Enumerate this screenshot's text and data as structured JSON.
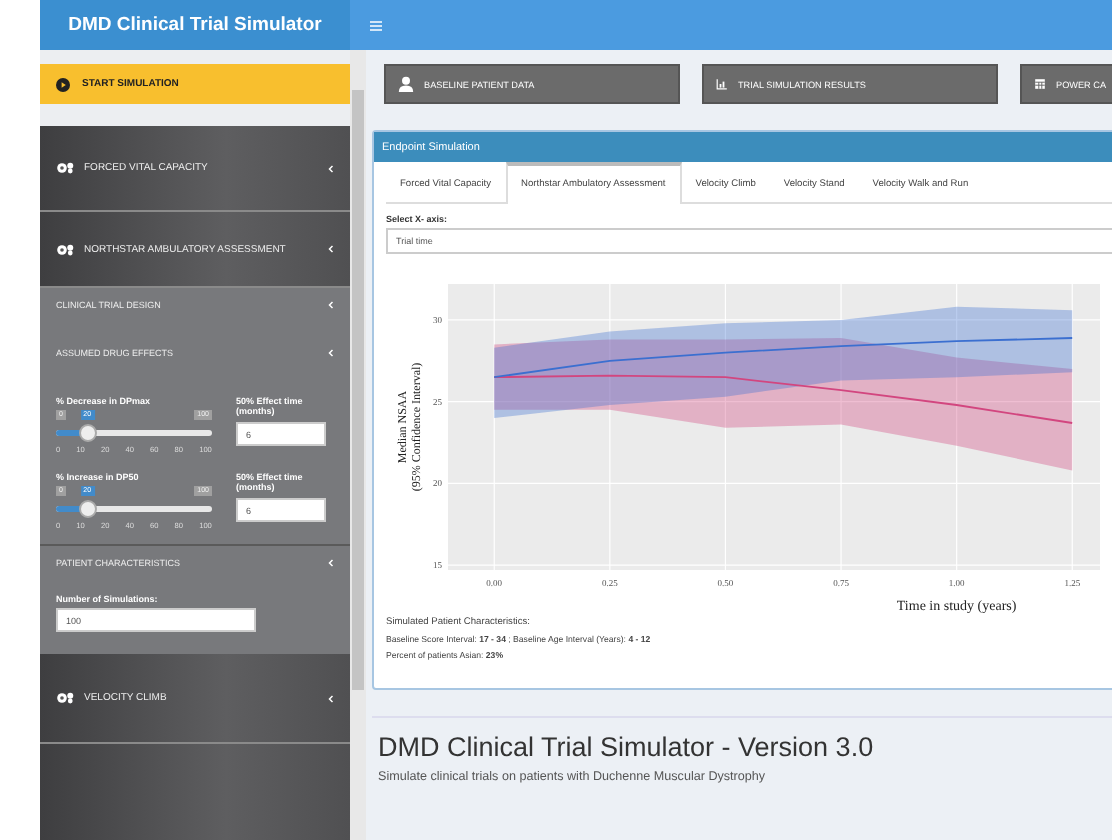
{
  "header": {
    "title": "DMD Clinical Trial Simulator"
  },
  "sidebar": {
    "start_button": "START SIMULATION",
    "menu": [
      {
        "label": "FORCED VITAL CAPACITY"
      },
      {
        "label": "NORTHSTAR AMBULATORY ASSESSMENT",
        "sections": [
          {
            "kind": "header",
            "label": "CLINICAL TRIAL DESIGN"
          },
          {
            "kind": "header",
            "label": "ASSUMED DRUG EFFECTS"
          },
          {
            "kind": "effects",
            "rows": [
              {
                "label": "% Decrease in DPmax",
                "min_label": "0",
                "max_label": "100",
                "value": "20",
                "level": 0.2,
                "ticks": [
                  "0",
                  "10",
                  "20",
                  "40",
                  "60",
                  "80",
                  "100"
                ],
                "effect_label": "50% Effect time (months)",
                "effect_value": "6"
              },
              {
                "label": "% Increase in DP50",
                "min_label": "0",
                "max_label": "100",
                "value": "20",
                "level": 0.2,
                "ticks": [
                  "0",
                  "10",
                  "20",
                  "40",
                  "60",
                  "80",
                  "100"
                ],
                "effect_label": "50% Effect time (months)",
                "effect_value": "6"
              }
            ]
          },
          {
            "kind": "header",
            "label": "PATIENT CHARACTERISTICS"
          },
          {
            "kind": "number",
            "label": "Number of Simulations:",
            "value": "100"
          }
        ]
      },
      {
        "label": "VELOCITY CLIMB"
      }
    ]
  },
  "buttons": [
    "BASELINE PATIENT DATA",
    "TRIAL SIMULATION RESULTS",
    "POWER CA"
  ],
  "panel": {
    "title": "Endpoint Simulation",
    "tabs": [
      {
        "label": "Forced Vital Capacity",
        "selected": false
      },
      {
        "label": "Northstar Ambulatory Assessment",
        "selected": true
      },
      {
        "label": "Velocity Climb",
        "selected": false
      },
      {
        "label": "Velocity Stand",
        "selected": false
      },
      {
        "label": "Velocity Walk and Run",
        "selected": false
      }
    ],
    "x_axis": {
      "label": "Select X- axis:",
      "value": "Trial time"
    },
    "chart_data": {
      "type": "line",
      "xlabel": "Time in study (years)",
      "ylabel": [
        "Median NSAA",
        "(95% Confidence Interval)"
      ],
      "x": [
        0,
        0.25,
        0.5,
        0.75,
        1,
        1.25
      ],
      "xlim": [
        -0.1,
        1.31
      ],
      "ylim": [
        14.7,
        32.2
      ],
      "xticks": [
        {
          "value": 0,
          "label": "0.00"
        },
        {
          "value": 0.25,
          "label": "0.25"
        },
        {
          "value": 0.5,
          "label": "0.50"
        },
        {
          "value": 0.75,
          "label": "0.75"
        },
        {
          "value": 1,
          "label": "1.00"
        },
        {
          "value": 1.25,
          "label": "1.25"
        }
      ],
      "yticks": [
        15,
        20,
        25,
        30
      ],
      "grid": true,
      "series": [
        {
          "color": "#d2467f",
          "values": [
            26.5,
            26.6,
            26.5,
            25.7,
            24.8,
            23.7
          ],
          "lower": [
            24.5,
            24.5,
            23.4,
            23.6,
            22.3,
            20.8
          ],
          "upper": [
            28.5,
            28.8,
            28.8,
            28.9,
            27.7,
            27
          ]
        },
        {
          "color": "#3b6fd0",
          "values": [
            26.5,
            27.5,
            28,
            28.4,
            28.7,
            28.9
          ],
          "lower": [
            24,
            24.8,
            25.3,
            26.3,
            26.5,
            26.8
          ],
          "upper": [
            28.3,
            29.3,
            29.8,
            30,
            30.8,
            30.6
          ]
        }
      ]
    },
    "notes": {
      "heading": "Simulated Patient Characteristics:",
      "lines": [
        "Baseline Score Interval: **17 - 34** ; Baseline Age Interval (Years): **4 - 12**",
        "Percent of patients Asian: **23%**"
      ]
    }
  },
  "footer": {
    "title": "DMD Clinical Trial Simulator - Version 3.0",
    "subtitle": "Simulate clinical trials on patients with Duchenne Muscular Dystrophy"
  }
}
